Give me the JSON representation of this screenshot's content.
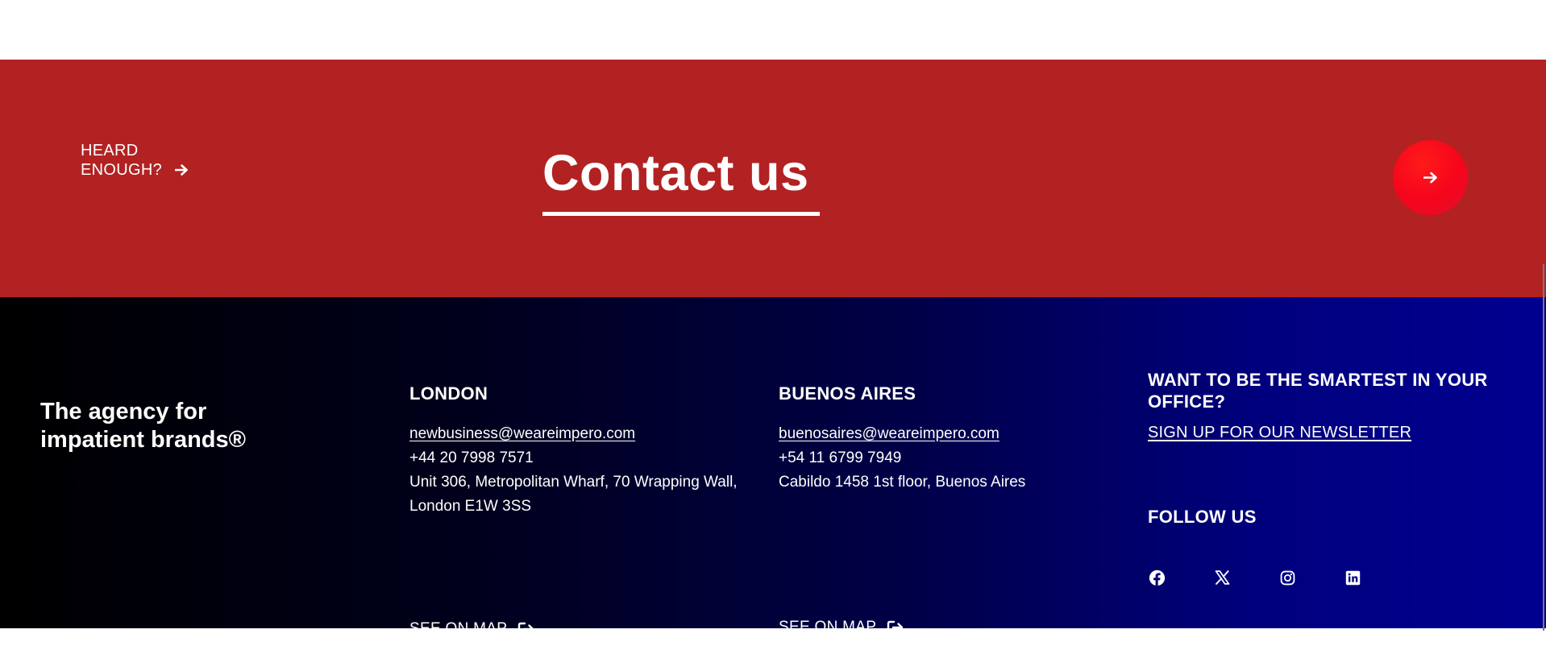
{
  "cta": {
    "heard_line1": "HEARD",
    "heard_line2": "ENOUGH?",
    "title": "Contact us",
    "arrow_icon": "arrow-right-icon"
  },
  "footer": {
    "tagline": "The agency for impatient brands®",
    "london": {
      "title": "LONDON",
      "email": "newbusiness@weareimpero.com",
      "phone": "+44 20 7998 7571",
      "address": "Unit 306, Metropolitan Wharf, 70 Wrapping Wall, London E1W 3SS",
      "map_label": "SEE ON MAP"
    },
    "buenos_aires": {
      "title": "BUENOS AIRES",
      "email": "buenosaires@weareimpero.com",
      "phone": "+54 11 6799 7949",
      "address": "Cabildo 1458 1st floor, Buenos Aires",
      "map_label": "SEE ON MAP"
    },
    "newsletter": {
      "title": "WANT TO BE THE SMARTEST IN YOUR OFFICE?",
      "signup_label": "SIGN UP FOR OUR NEWSLETTER"
    },
    "follow": {
      "title": "FOLLOW US",
      "icons": [
        "facebook-icon",
        "x-icon",
        "instagram-icon",
        "linkedin-icon"
      ]
    }
  },
  "colors": {
    "cta_background": "#b22222",
    "button_red": "#f5051c",
    "footer_gradient_start": "#000000",
    "footer_gradient_end": "#000090",
    "text": "#ffffff"
  }
}
